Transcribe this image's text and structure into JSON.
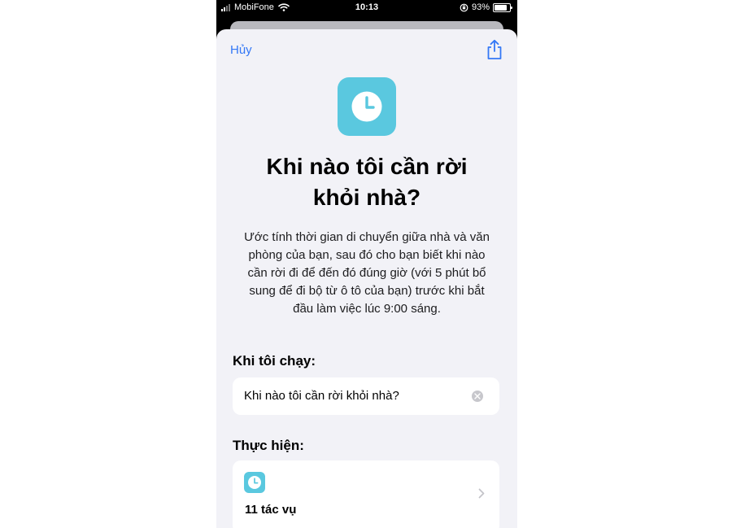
{
  "status_bar": {
    "carrier": "MobiFone",
    "time": "10:13",
    "battery": "93%"
  },
  "nav": {
    "cancel_label": "Hủy"
  },
  "shortcut": {
    "title_line1": "Khi nào tôi cần rời",
    "title_line2": "khỏi nhà?",
    "description": "Ước tính thời gian di chuyển giữa nhà và văn phòng của bạn, sau đó cho bạn biết khi nào cần rời đi để đến đó đúng giờ (với 5 phút bổ sung để đi bộ từ ô tô của bạn) trước khi bắt đầu làm việc lúc 9:00 sáng.",
    "icon": "clock-icon",
    "accent_color": "#5ac8df"
  },
  "when_run": {
    "label": "Khi tôi chạy:",
    "value": "Khi nào tôi cần rời khỏi nhà?"
  },
  "actions": {
    "label": "Thực hiện:",
    "count_label": "11 tác vụ"
  },
  "colors": {
    "link": "#3478f6",
    "sheet_background": "#f2f2f7"
  }
}
